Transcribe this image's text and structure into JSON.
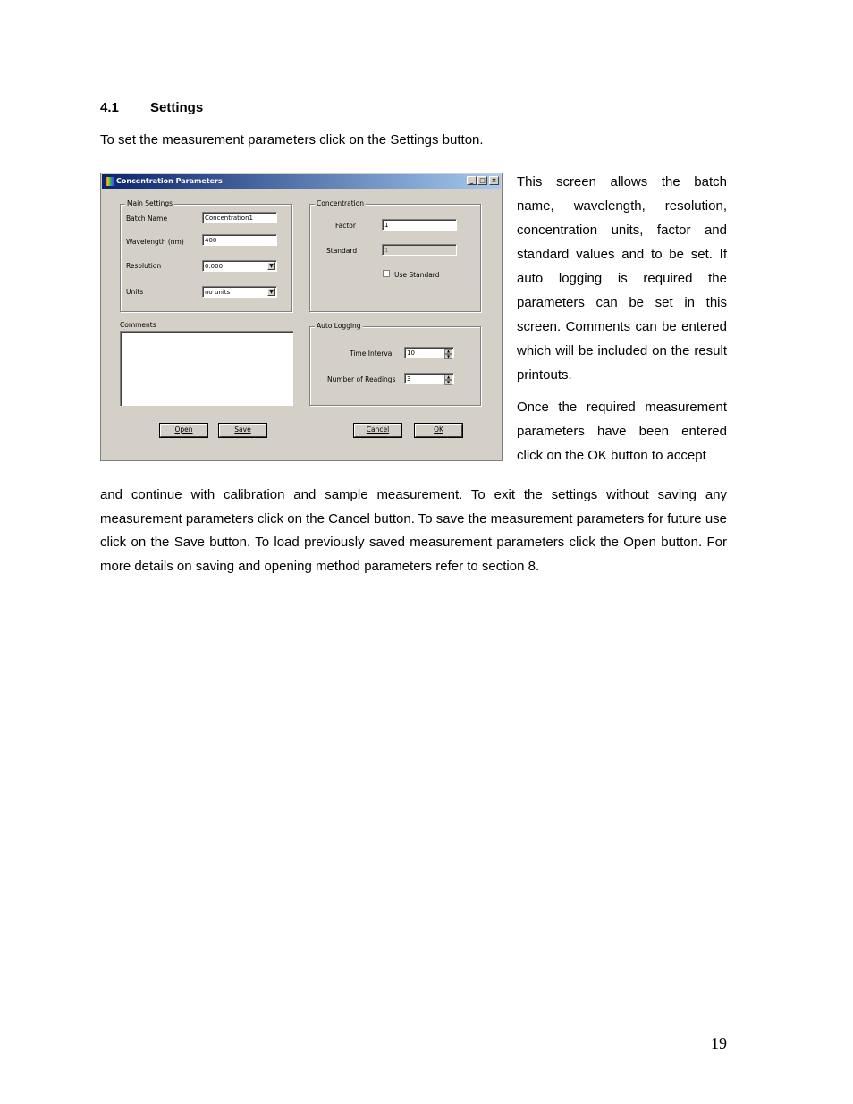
{
  "section": {
    "number": "4.1",
    "title": "Settings"
  },
  "intro": "To set the measurement parameters click on the Settings button.",
  "side_paragraphs": [
    "This screen allows the batch name, wavelength, resolution, concentration units, factor and standard values and to be set. If auto logging is required the parameters can be set in this screen. Comments can be entered which will be included on the result printouts.",
    "Once the required measurement parameters have been entered click on the OK button to accept"
  ],
  "body_paragraph": "and continue with calibration and sample measurement. To exit the settings without saving any measurement parameters click on the Cancel button. To save the measurement parameters for future use click on the Save button. To load previously saved measurement parameters click the Open button.  For more details on saving and opening method parameters refer to section 8.",
  "page_number": "19",
  "dialog": {
    "title": "Concentration Parameters",
    "window_buttons": {
      "minimize": "_",
      "maximize": "□",
      "close": "×"
    },
    "main_settings": {
      "legend": "Main Settings",
      "batch_name_label": "Batch Name",
      "batch_name_value": "Concentration1",
      "wavelength_label": "Wavelength (nm)",
      "wavelength_value": "400",
      "resolution_label": "Resolution",
      "resolution_value": "0.000",
      "units_label": "Units",
      "units_value": "no units"
    },
    "concentration": {
      "legend": "Concentration",
      "factor_label": "Factor",
      "factor_value": "1",
      "standard_label": "Standard",
      "standard_value": "1",
      "use_standard_label": "Use Standard",
      "use_standard_checked": false
    },
    "comments": {
      "label": "Comments",
      "value": ""
    },
    "auto_logging": {
      "legend": "Auto Logging",
      "time_interval_label": "Time Interval",
      "time_interval_value": "10",
      "readings_label": "Number of Readings",
      "readings_value": "3"
    },
    "buttons": {
      "open": "Open",
      "save": "Save",
      "cancel": "Cancel",
      "ok": "OK"
    }
  }
}
